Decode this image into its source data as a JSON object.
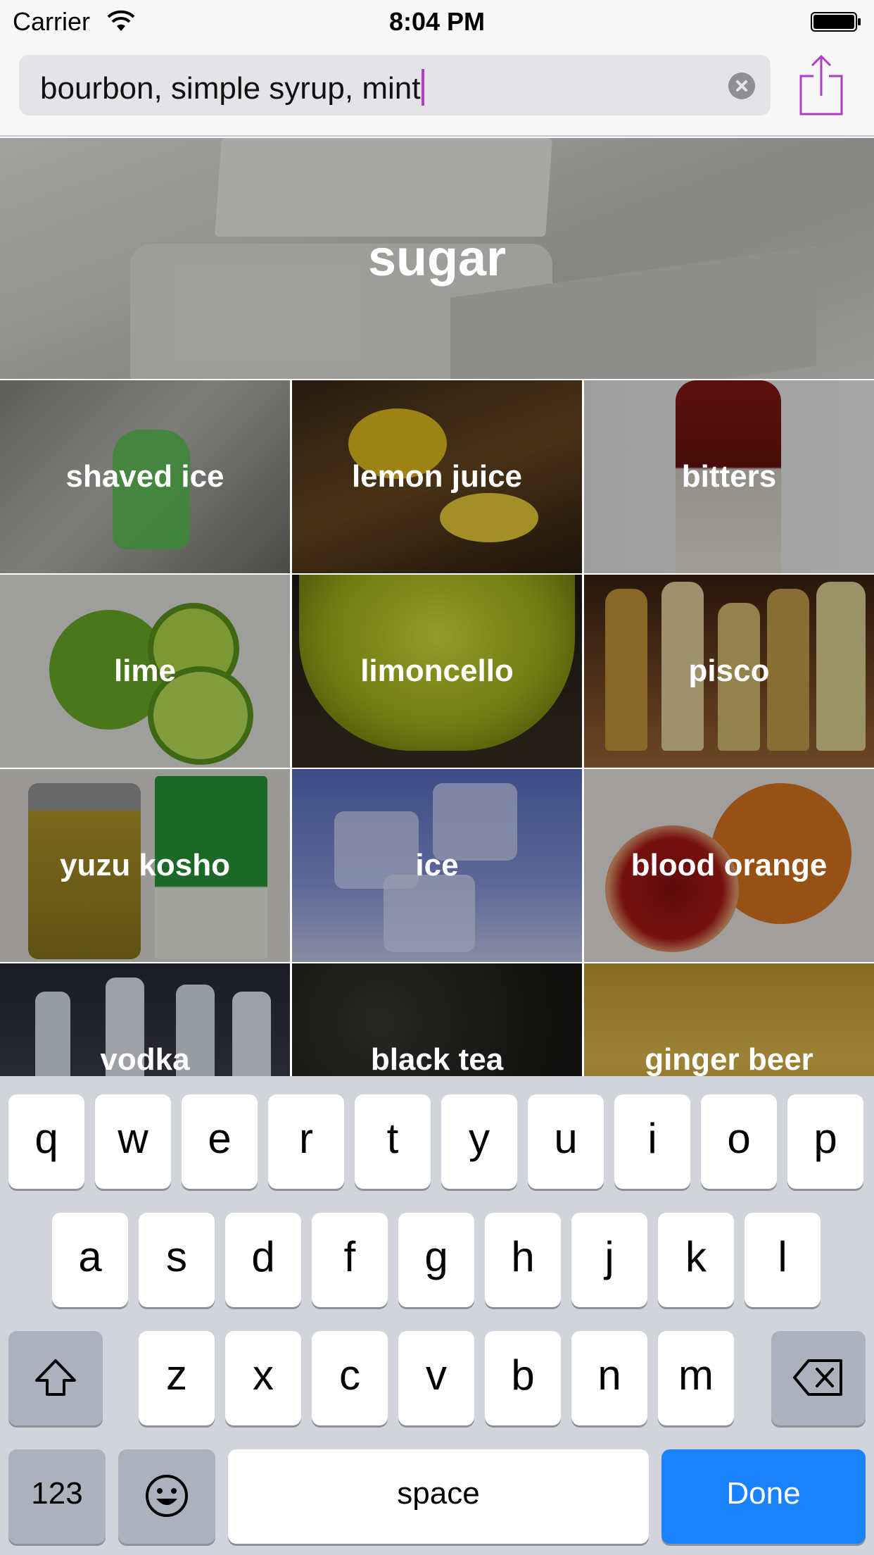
{
  "status_bar": {
    "carrier": "Carrier",
    "time": "8:04 PM"
  },
  "search": {
    "value": "bourbon, simple syrup, mint"
  },
  "hero": {
    "label": "sugar"
  },
  "tiles": [
    {
      "label": "shaved ice"
    },
    {
      "label": "lemon juice"
    },
    {
      "label": "bitters"
    },
    {
      "label": "lime"
    },
    {
      "label": "limoncello"
    },
    {
      "label": "pisco"
    },
    {
      "label": "yuzu kosho"
    },
    {
      "label": "ice"
    },
    {
      "label": "blood orange"
    },
    {
      "label": "vodka"
    },
    {
      "label": "black tea"
    },
    {
      "label": "ginger beer"
    }
  ],
  "keyboard": {
    "row1": [
      "q",
      "w",
      "e",
      "r",
      "t",
      "y",
      "u",
      "i",
      "o",
      "p"
    ],
    "row2": [
      "a",
      "s",
      "d",
      "f",
      "g",
      "h",
      "j",
      "k",
      "l"
    ],
    "row3": [
      "z",
      "x",
      "c",
      "v",
      "b",
      "n",
      "m"
    ],
    "numbers_label": "123",
    "space_label": "space",
    "done_label": "Done"
  },
  "colors": {
    "accent": "#b03cc8",
    "done": "#1a82fb",
    "keyboard_bg": "#d1d4db"
  }
}
